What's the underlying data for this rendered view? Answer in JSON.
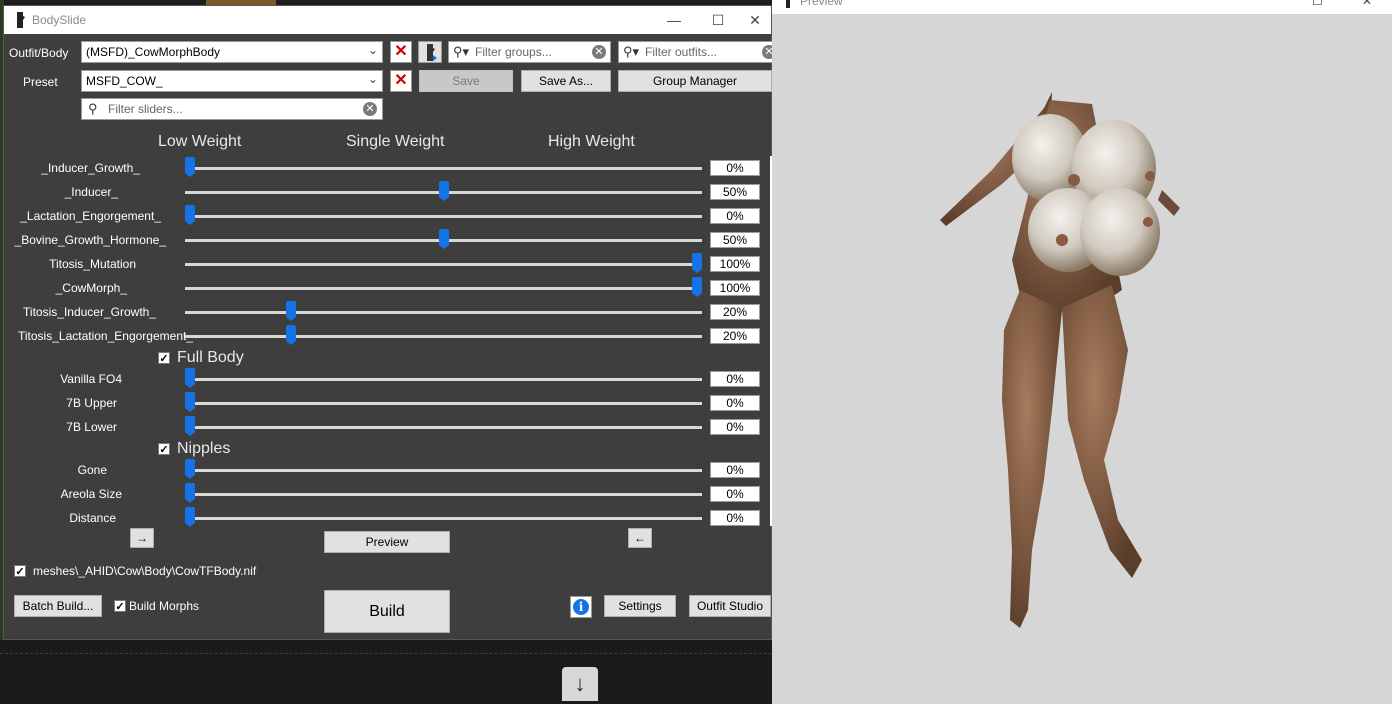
{
  "bodyslide": {
    "title": "BodySlide",
    "window_controls": {
      "minimize": "—",
      "maximize": "☐",
      "close": "✕"
    },
    "outfit_label": "Outfit/Body",
    "outfit_value": "(MSFD)_CowMorphBody",
    "preset_label": "Preset",
    "preset_value": "MSFD_COW_",
    "filter_groups_placeholder": "Filter groups...",
    "filter_outfits_placeholder": "Filter outfits...",
    "filter_sliders_placeholder": "Filter sliders...",
    "save_label": "Save",
    "save_as_label": "Save As...",
    "group_manager_label": "Group Manager",
    "headers": {
      "low": "Low Weight",
      "single": "Single Weight",
      "high": "High Weight"
    },
    "sliders": [
      {
        "label": "_Inducer_Growth_",
        "value": "0%",
        "level": 0
      },
      {
        "label": "_Inducer_",
        "value": "50%",
        "level": 50
      },
      {
        "label": "_Lactation_Engorgement_",
        "value": "0%",
        "level": 0
      },
      {
        "label": "_Bovine_Growth_Hormone_",
        "value": "50%",
        "level": 50
      },
      {
        "label": "Titosis_Mutation",
        "value": "100%",
        "level": 100
      },
      {
        "label": "_CowMorph_",
        "value": "100%",
        "level": 100
      },
      {
        "label": "Titosis_Inducer_Growth_",
        "value": "20%",
        "level": 20
      },
      {
        "label": "Titosis_Lactation_Engorgement_",
        "value": "20%",
        "level": 20
      }
    ],
    "full_body_group": "Full Body",
    "full_body_sliders": [
      {
        "label": "Vanilla FO4",
        "value": "0%",
        "level": 0
      },
      {
        "label": "7B Upper",
        "value": "0%",
        "level": 0
      },
      {
        "label": "7B Lower",
        "value": "0%",
        "level": 0
      }
    ],
    "nipples_group": "Nipples",
    "nipples_sliders": [
      {
        "label": "Gone",
        "value": "0%",
        "level": 0
      },
      {
        "label": "Areola Size",
        "value": "0%",
        "level": 0
      },
      {
        "label": "Distance",
        "value": "0%",
        "level": 0
      }
    ],
    "arrow_right": "→",
    "arrow_left": "←",
    "preview_label": "Preview",
    "output_path": "meshes\\_AHID\\Cow\\Body\\CowTFBody.nif",
    "batch_build_label": "Batch Build...",
    "build_morphs_label": "Build Morphs",
    "build_label": "Build",
    "info_icon": "i",
    "settings_label": "Settings",
    "outfit_studio_label": "Outfit Studio",
    "check_mark": "✓",
    "red_x": "✕"
  },
  "preview": {
    "title": "Preview"
  },
  "taskbar": {
    "download_icon_glyph": "↓"
  },
  "colors": {
    "accent": "#1473e6",
    "window_bg": "#3e3e3e",
    "preview_bg": "#d6d6d6",
    "red_x": "#d00000"
  }
}
